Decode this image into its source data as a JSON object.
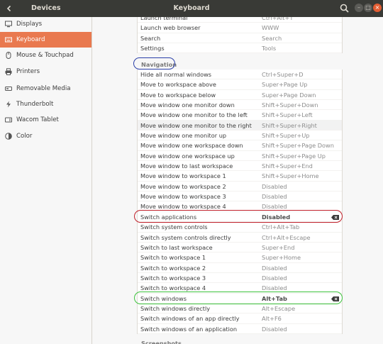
{
  "header": {
    "sidebar_title": "Devices",
    "title": "Keyboard",
    "back_icon": "chevron-left",
    "search_icon": "search",
    "window_controls": {
      "minimize": "–",
      "maximize": "□",
      "close": "×"
    }
  },
  "sidebar": {
    "items": [
      {
        "label": "Displays",
        "icon": "display-icon"
      },
      {
        "label": "Keyboard",
        "icon": "keyboard-icon",
        "active": true
      },
      {
        "label": "Mouse & Touchpad",
        "icon": "mouse-icon"
      },
      {
        "label": "Printers",
        "icon": "printer-icon"
      },
      {
        "label": "Removable Media",
        "icon": "removable-media-icon"
      },
      {
        "label": "Thunderbolt",
        "icon": "thunderbolt-icon"
      },
      {
        "label": "Wacom Tablet",
        "icon": "tablet-icon"
      },
      {
        "label": "Color",
        "icon": "color-icon"
      }
    ]
  },
  "launchers": [
    {
      "name": "Launch terminal",
      "accel": "Ctrl+Alt+T"
    },
    {
      "name": "Launch web browser",
      "accel": "WWW"
    },
    {
      "name": "Search",
      "accel": "Search"
    },
    {
      "name": "Settings",
      "accel": "Tools"
    }
  ],
  "navigation": {
    "heading": "Navigation",
    "rows": [
      {
        "name": "Hide all normal windows",
        "accel": "Ctrl+Super+D"
      },
      {
        "name": "Move to workspace above",
        "accel": "Super+Page Up"
      },
      {
        "name": "Move to workspace below",
        "accel": "Super+Page Down"
      },
      {
        "name": "Move window one monitor down",
        "accel": "Shift+Super+Down"
      },
      {
        "name": "Move window one monitor to the left",
        "accel": "Shift+Super+Left"
      },
      {
        "name": "Move window one monitor to the right",
        "accel": "Shift+Super+Right"
      },
      {
        "name": "Move window one monitor up",
        "accel": "Shift+Super+Up"
      },
      {
        "name": "Move window one workspace down",
        "accel": "Shift+Super+Page Down"
      },
      {
        "name": "Move window one workspace up",
        "accel": "Shift+Super+Page Up"
      },
      {
        "name": "Move window to last workspace",
        "accel": "Shift+Super+End"
      },
      {
        "name": "Move window to workspace 1",
        "accel": "Shift+Super+Home"
      },
      {
        "name": "Move window to workspace 2",
        "accel": "Disabled"
      },
      {
        "name": "Move window to workspace 3",
        "accel": "Disabled"
      },
      {
        "name": "Move window to workspace 4",
        "accel": "Disabled"
      },
      {
        "name": "Switch applications",
        "accel": "Disabled",
        "bold": true,
        "clear": true
      },
      {
        "name": "Switch system controls",
        "accel": "Ctrl+Alt+Tab"
      },
      {
        "name": "Switch system controls directly",
        "accel": "Ctrl+Alt+Escape"
      },
      {
        "name": "Switch to last workspace",
        "accel": "Super+End"
      },
      {
        "name": "Switch to workspace 1",
        "accel": "Super+Home"
      },
      {
        "name": "Switch to workspace 2",
        "accel": "Disabled"
      },
      {
        "name": "Switch to workspace 3",
        "accel": "Disabled"
      },
      {
        "name": "Switch to workspace 4",
        "accel": "Disabled"
      },
      {
        "name": "Switch windows",
        "accel": "Alt+Tab",
        "bold": true,
        "clear": true
      },
      {
        "name": "Switch windows directly",
        "accel": "Alt+Escape"
      },
      {
        "name": "Switch windows of an app directly",
        "accel": "Alt+F6"
      },
      {
        "name": "Switch windows of an application",
        "accel": "Disabled"
      }
    ]
  },
  "next_section": {
    "heading": "Screenshots"
  },
  "colors": {
    "accent": "#e9794f",
    "header_bg": "#393a36",
    "annotation_blue": "#2a3fa8",
    "annotation_red": "#c0202a",
    "annotation_green": "#3ec43e"
  }
}
